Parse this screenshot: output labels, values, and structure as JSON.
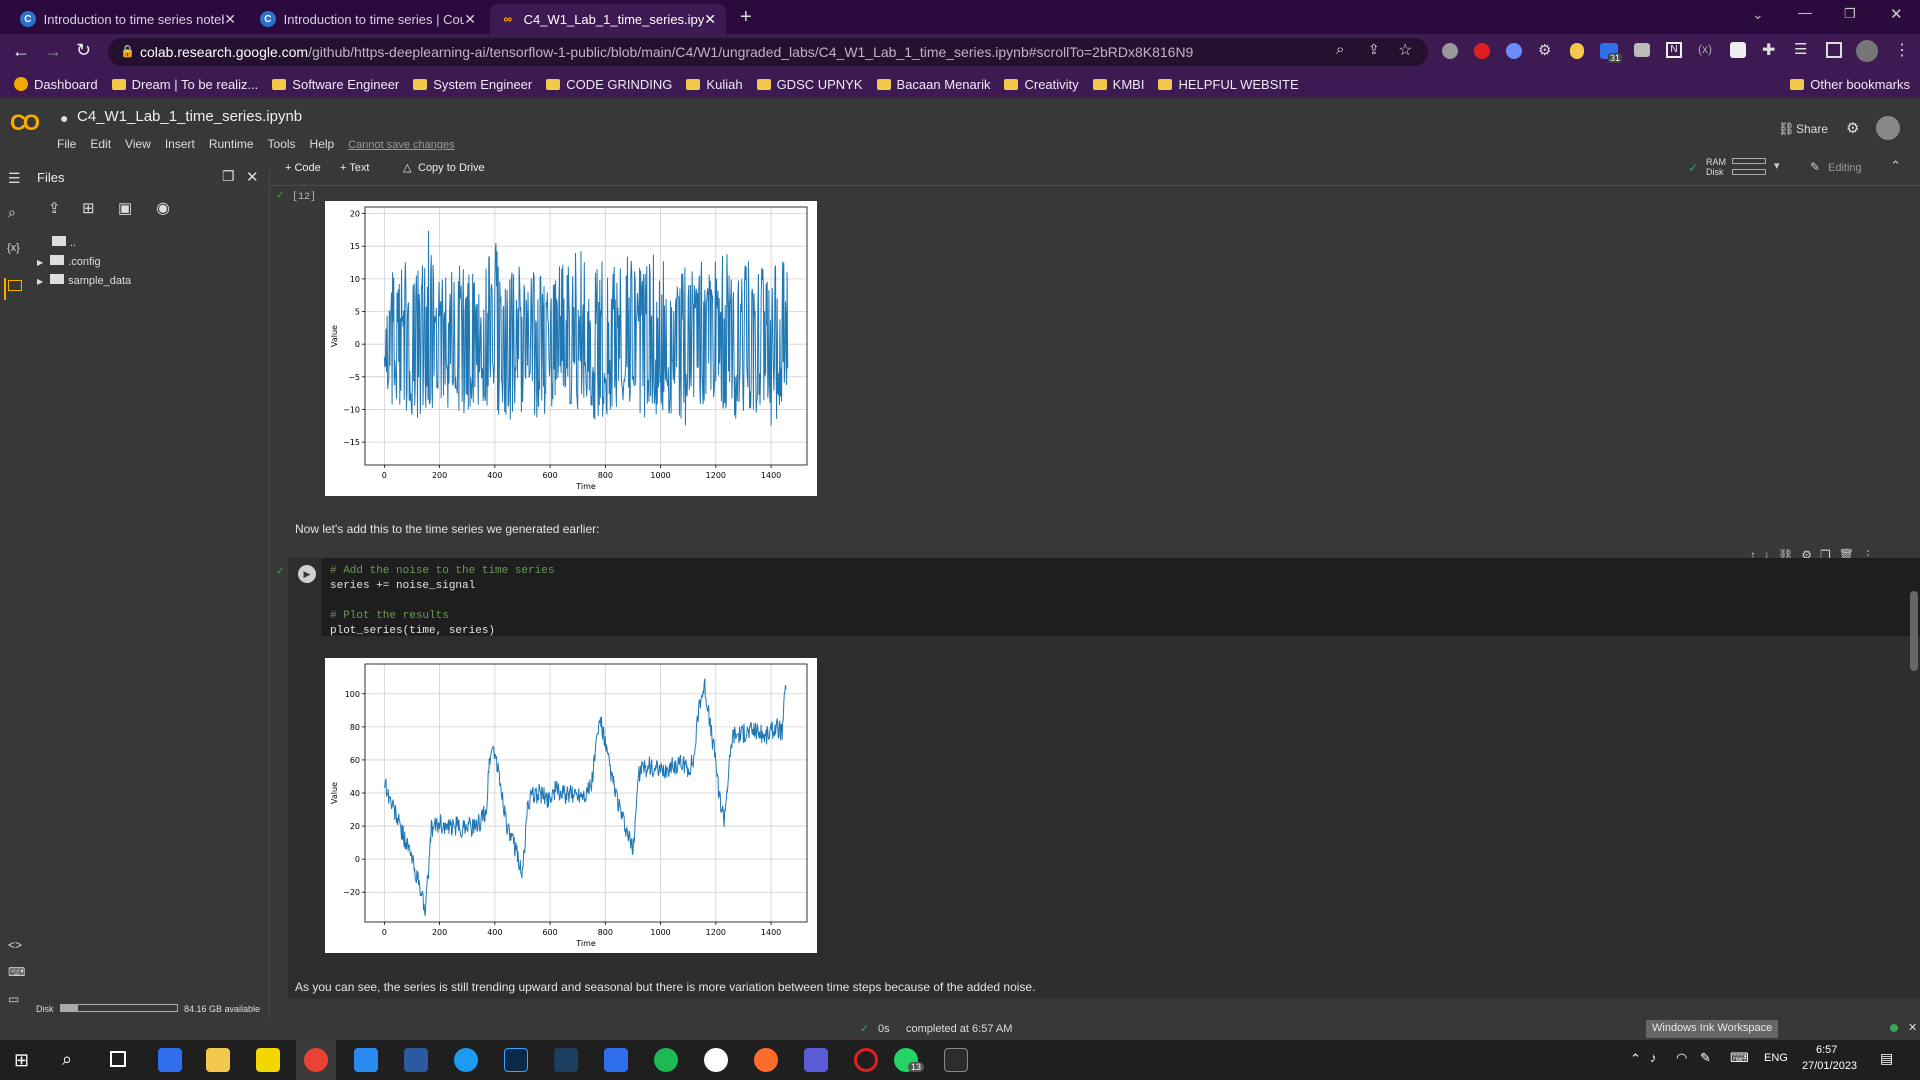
{
  "browser": {
    "tabs": [
      {
        "title": "Introduction to time series noteb",
        "favicon": "coursera-icon"
      },
      {
        "title": "Introduction to time series | Cou",
        "favicon": "coursera-icon"
      },
      {
        "title": "C4_W1_Lab_1_time_series.ipynb",
        "favicon": "colab-icon"
      }
    ],
    "url_host": "colab.research.google.com",
    "url_path": "/github/https-deeplearning-ai/tensorflow-1-public/blob/main/C4/W1/ungraded_labs/C4_W1_Lab_1_time_series.ipynb#scrollTo=2bRDx8K816N9",
    "extension_badge": "31",
    "bookmarks": [
      "Dashboard",
      "Dream | To be realiz...",
      "Software Engineer",
      "System Engineer",
      "CODE GRINDING",
      "Kuliah",
      "GDSC UPNYK",
      "Bacaan Menarik",
      "Creativity",
      "KMBI",
      "HELPFUL WEBSITE"
    ],
    "other_bookmarks": "Other bookmarks"
  },
  "colab": {
    "logo": "CO",
    "notebook_title": "C4_W1_Lab_1_time_series.ipynb",
    "menu": [
      "File",
      "Edit",
      "View",
      "Insert",
      "Runtime",
      "Tools",
      "Help"
    ],
    "save_notice": "Cannot save changes",
    "share": "Share",
    "toolbar": {
      "code": "+ Code",
      "text": "+ Text",
      "copy": "Copy to Drive"
    },
    "ram_label": "RAM",
    "disk_label": "Disk",
    "editing": "Editing"
  },
  "sidebar": {
    "title": "Files",
    "tree": [
      "..",
      ".config",
      "sample_data"
    ],
    "disk_label": "Disk",
    "disk_available": "84.16 GB available",
    "disk_usage_fraction": 0.15
  },
  "notebook": {
    "cell12_count": "[12]",
    "markdown1": "Now let's add this to the time series we generated earlier:",
    "code_lines": [
      {
        "text": "# Add the noise to the time series",
        "comment": true
      },
      {
        "text": "series += noise_signal",
        "comment": false
      },
      {
        "text": "",
        "comment": false
      },
      {
        "text": "# Plot the results",
        "comment": true
      },
      {
        "text": "plot_series(time, series)",
        "comment": false
      }
    ],
    "markdown2": "As you can see, the series is still trending upward and seasonal but there is more variation between time steps because of the added noise."
  },
  "chart_data": [
    {
      "type": "line",
      "xlabel": "Time",
      "ylabel": "Value",
      "xlim": [
        -70,
        1530
      ],
      "ylim": [
        -18.5,
        21
      ],
      "xticks": [
        0,
        200,
        400,
        600,
        800,
        1000,
        1200,
        1400
      ],
      "yticks": [
        -15,
        -10,
        -5,
        0,
        5,
        10,
        15,
        20
      ],
      "ytick_labels": [
        "−15",
        "−10",
        "−5",
        "0",
        "5",
        "10",
        "15",
        "20"
      ],
      "grid": true,
      "series": [
        {
          "color": "#1f77b4",
          "description_x_range": [
            0,
            1460
          ],
          "x": [
            0,
            40,
            80,
            120,
            160,
            200,
            240,
            280,
            320,
            360,
            400,
            440,
            480,
            520,
            560,
            600,
            640,
            680,
            720,
            760,
            800,
            840,
            880,
            920,
            960,
            1000,
            1040,
            1080,
            1120,
            1160,
            1200,
            1240,
            1280,
            1320,
            1360,
            1400,
            1440,
            1460
          ],
          "upper": [
            11,
            12,
            13,
            14,
            19,
            11,
            12,
            13,
            11,
            12,
            16,
            11,
            12,
            12,
            11,
            12,
            13,
            14,
            15,
            12,
            13,
            12,
            14,
            12,
            13,
            15,
            13,
            12,
            12,
            13,
            13,
            14,
            12,
            13,
            12,
            12,
            13,
            13
          ],
          "lower": [
            -9,
            -10,
            -11,
            -12,
            -10,
            -11,
            -10,
            -12,
            -9,
            -11,
            -10,
            -13,
            -10,
            -11,
            -12,
            -10,
            -10,
            -11,
            -10,
            -12,
            -11,
            -10,
            -12,
            -13,
            -10,
            -12,
            -11,
            -13,
            -11,
            -10,
            -10,
            -11,
            -12,
            -10,
            -11,
            -13,
            -10,
            -9
          ]
        }
      ]
    },
    {
      "type": "line",
      "xlabel": "Time",
      "ylabel": "Value",
      "xlim": [
        -70,
        1530
      ],
      "ylim": [
        -38,
        118
      ],
      "xticks": [
        0,
        200,
        400,
        600,
        800,
        1000,
        1200,
        1400
      ],
      "yticks": [
        -20,
        0,
        20,
        40,
        60,
        80,
        100
      ],
      "ytick_labels": [
        "−20",
        "0",
        "20",
        "40",
        "60",
        "80",
        "100"
      ],
      "grid": true,
      "series": [
        {
          "color": "#1f77b4",
          "x": [
            0,
            20,
            40,
            60,
            80,
            100,
            120,
            140,
            150,
            170,
            200,
            230,
            260,
            280,
            300,
            330,
            370,
            380,
            395,
            410,
            430,
            450,
            480,
            500,
            520,
            540,
            560,
            590,
            620,
            660,
            700,
            730,
            750,
            760,
            780,
            790,
            810,
            830,
            860,
            880,
            900,
            920,
            940,
            960,
            1000,
            1030,
            1070,
            1100,
            1120,
            1140,
            1160,
            1180,
            1200,
            1210,
            1230,
            1260,
            1300,
            1340,
            1380,
            1420,
            1440,
            1455
          ],
          "y": [
            48,
            36,
            28,
            18,
            10,
            0,
            -12,
            -25,
            -30,
            18,
            22,
            18,
            20,
            18,
            22,
            18,
            30,
            60,
            68,
            55,
            35,
            15,
            5,
            -10,
            35,
            38,
            40,
            36,
            42,
            38,
            40,
            40,
            45,
            60,
            85,
            78,
            60,
            45,
            25,
            15,
            5,
            52,
            55,
            56,
            52,
            55,
            58,
            55,
            60,
            95,
            105,
            80,
            60,
            40,
            25,
            75,
            76,
            78,
            74,
            80,
            76,
            110
          ]
        }
      ]
    }
  ],
  "status": {
    "elapsed": "0s",
    "completed": "completed at 6:57 AM"
  },
  "windows_ink": "Windows Ink Workspace",
  "taskbar": {
    "lang": "ENG",
    "time": "6:57",
    "date": "27/01/2023",
    "whatsapp_badge": "13"
  }
}
